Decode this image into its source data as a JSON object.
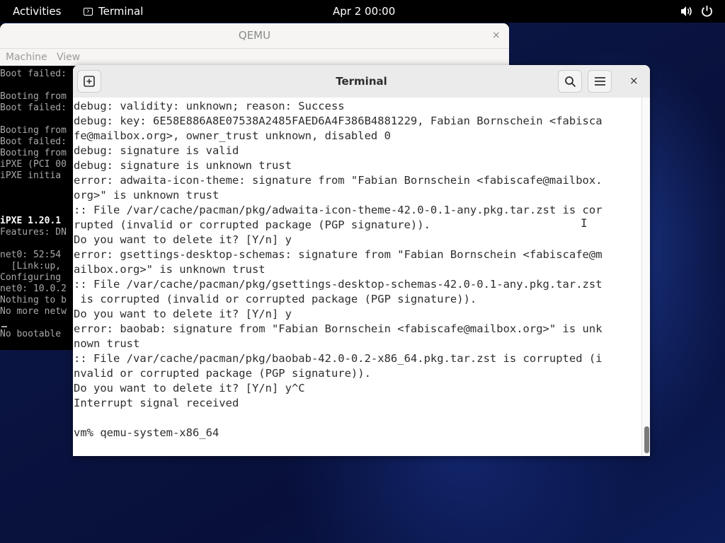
{
  "topbar": {
    "activities": "Activities",
    "app_name": "Terminal",
    "clock": "Apr 2  00:00"
  },
  "qemu": {
    "title": "QEMU",
    "close": "×",
    "menu": [
      "Machine",
      "View"
    ],
    "lines": [
      {
        "text": "Boot failed:",
        "bright": false
      },
      {
        "text": "",
        "bright": false
      },
      {
        "text": "Booting from",
        "bright": false
      },
      {
        "text": "Boot failed:",
        "bright": false
      },
      {
        "text": "",
        "bright": false
      },
      {
        "text": "Booting from",
        "bright": false
      },
      {
        "text": "Boot failed:",
        "bright": false
      },
      {
        "text": "Booting from",
        "bright": false
      },
      {
        "text": "iPXE (PCI 00",
        "bright": false
      },
      {
        "text": "iPXE initia",
        "bright": false
      },
      {
        "text": "",
        "bright": false
      },
      {
        "text": "",
        "bright": false
      },
      {
        "text": "iPXE 1.20.1",
        "bright": true
      },
      {
        "text": "Features: DN",
        "bright": false
      },
      {
        "text": "",
        "bright": false
      },
      {
        "text": "net0: 52:54",
        "bright": false
      },
      {
        "text": "  [Link:up,",
        "bright": false
      },
      {
        "text": "Configuring",
        "bright": false
      },
      {
        "text": "net0: 10.0.2",
        "bright": false
      },
      {
        "text": "Nothing to b",
        "bright": false
      },
      {
        "text": "No more netw",
        "bright": false
      },
      {
        "text": "",
        "bright": false
      },
      {
        "text": "No bootable",
        "bright": false
      }
    ]
  },
  "terminal": {
    "title": "Terminal",
    "close": "×",
    "lines": [
      "debug: validity: unknown; reason: Success",
      "debug: key: 6E58E886A8E07538A2485FAED6A4F386B4881229, Fabian Bornschein <fabisca",
      "fe@mailbox.org>, owner_trust unknown, disabled 0",
      "debug: signature is valid",
      "debug: signature is unknown trust",
      "error: adwaita-icon-theme: signature from \"Fabian Bornschein <fabiscafe@mailbox.",
      "org>\" is unknown trust",
      ":: File /var/cache/pacman/pkg/adwaita-icon-theme-42.0-0.1-any.pkg.tar.zst is cor",
      "rupted (invalid or corrupted package (PGP signature)).",
      "Do you want to delete it? [Y/n] y",
      "error: gsettings-desktop-schemas: signature from \"Fabian Bornschein <fabiscafe@m",
      "ailbox.org>\" is unknown trust",
      ":: File /var/cache/pacman/pkg/gsettings-desktop-schemas-42.0-0.1-any.pkg.tar.zst",
      " is corrupted (invalid or corrupted package (PGP signature)).",
      "Do you want to delete it? [Y/n] y",
      "error: baobab: signature from \"Fabian Bornschein <fabiscafe@mailbox.org>\" is unk",
      "nown trust",
      ":: File /var/cache/pacman/pkg/baobab-42.0-0.2-x86_64.pkg.tar.zst is corrupted (i",
      "nvalid or corrupted package (PGP signature)).",
      "Do you want to delete it? [Y/n] y^C",
      "Interrupt signal received",
      "",
      "vm% qemu-system-x86_64"
    ]
  }
}
